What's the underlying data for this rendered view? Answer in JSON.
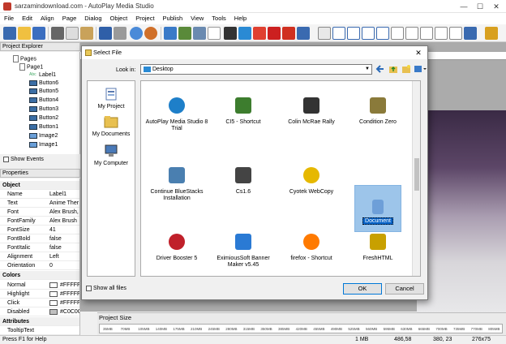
{
  "window": {
    "title": "sarzamindownload.com - AutoPlay Media Studio",
    "minimize": "—",
    "maximize": "☐",
    "close": "✕"
  },
  "menu": [
    "File",
    "Edit",
    "Align",
    "Page",
    "Dialog",
    "Object",
    "Project",
    "Publish",
    "View",
    "Tools",
    "Help"
  ],
  "project_explorer": {
    "title": "Project Explorer",
    "tree": [
      {
        "label": "Pages",
        "kind": "folder",
        "depth": 0
      },
      {
        "label": "Page1",
        "kind": "page",
        "depth": 1
      },
      {
        "label": "Label1",
        "kind": "label",
        "depth": 2
      },
      {
        "label": "Button6",
        "kind": "button",
        "depth": 2
      },
      {
        "label": "Button5",
        "kind": "button",
        "depth": 2
      },
      {
        "label": "Button4",
        "kind": "button",
        "depth": 2
      },
      {
        "label": "Button3",
        "kind": "button",
        "depth": 2
      },
      {
        "label": "Button2",
        "kind": "button",
        "depth": 2
      },
      {
        "label": "Button1",
        "kind": "button",
        "depth": 2
      },
      {
        "label": "Image2",
        "kind": "image",
        "depth": 2
      },
      {
        "label": "Image1",
        "kind": "image",
        "depth": 2
      }
    ],
    "show_events": "Show Events"
  },
  "properties": {
    "title": "Properties",
    "rows": [
      {
        "kind": "category",
        "key": "Object"
      },
      {
        "key": "Name",
        "value": "Label1"
      },
      {
        "key": "Text",
        "value": "Anime Ther"
      },
      {
        "key": "Font",
        "value": "Alex Brush,"
      },
      {
        "key": "FontFamily",
        "value": "Alex Brush"
      },
      {
        "key": "FontSize",
        "value": "41"
      },
      {
        "key": "FontBold",
        "value": "false"
      },
      {
        "key": "FontItalic",
        "value": "false"
      },
      {
        "key": "Alignment",
        "value": "Left"
      },
      {
        "key": "Orientation",
        "value": "0"
      },
      {
        "kind": "category",
        "key": "Colors"
      },
      {
        "key": "Normal",
        "value": "#FFFFF",
        "swatch": "#FFFFFF"
      },
      {
        "key": "Highlight",
        "value": "#FFFFF",
        "swatch": "#FFFFFF"
      },
      {
        "key": "Click",
        "value": "#FFFFFF",
        "swatch": "#FFFFFF"
      },
      {
        "key": "Disabled",
        "value": "#C0C0C0",
        "swatch": "#C0C0C0"
      },
      {
        "kind": "category",
        "key": "Attributes"
      },
      {
        "key": "TooltipText",
        "value": ""
      }
    ]
  },
  "dialog": {
    "title": "Select File",
    "look_in_label": "Look in:",
    "look_in_value": "Desktop",
    "places": [
      {
        "label": "My Project",
        "icon": "project-icon"
      },
      {
        "label": "My Documents",
        "icon": "documents-folder-icon"
      },
      {
        "label": "My Computer",
        "icon": "computer-icon"
      }
    ],
    "files": [
      {
        "label": "AutoPlay Media Studio 8 Trial",
        "icon": "autoplay-icon",
        "color": "#1e7fc9"
      },
      {
        "label": "CI5 - Shortcut",
        "icon": "game-ci5-icon",
        "color": "#3d7d2e"
      },
      {
        "label": "Colin McRae Rally",
        "icon": "rally-icon",
        "color": "#333333"
      },
      {
        "label": "Condition Zero",
        "icon": "counter-strike-icon",
        "color": "#8a7a3a"
      },
      {
        "label": "Continue BlueStacks Installation",
        "icon": "bluestacks-installer-icon",
        "color": "#4a7fb0"
      },
      {
        "label": "Cs1.6",
        "icon": "counter-strike-icon",
        "color": "#444444"
      },
      {
        "label": "Cyotek WebCopy",
        "icon": "webcopy-icon",
        "color": "#e6b800"
      },
      {
        "label": "Document",
        "icon": "text-document-icon",
        "color": "#6e9fd8",
        "selected": true
      },
      {
        "label": "Driver Booster 5",
        "icon": "driver-booster-icon",
        "color": "#c0202a"
      },
      {
        "label": "EximiousSoft Banner Maker v5.45",
        "icon": "banner-maker-icon",
        "color": "#2a7ad4"
      },
      {
        "label": "firefox - Shortcut",
        "icon": "firefox-icon",
        "color": "#ff7a00"
      },
      {
        "label": "FreshHTML",
        "icon": "freshhtml-icon",
        "color": "#c8a000"
      }
    ],
    "show_all_files": "Show all files",
    "ok": "OK",
    "cancel": "Cancel"
  },
  "project_size": {
    "title": "Project Size",
    "ticks": [
      "35MB",
      "70MB",
      "105MB",
      "140MB",
      "175MB",
      "210MB",
      "245MB",
      "280MB",
      "315MB",
      "350MB",
      "385MB",
      "420MB",
      "455MB",
      "490MB",
      "525MB",
      "560MB",
      "595MB",
      "630MB",
      "665MB",
      "700MB",
      "735MB",
      "770MB",
      "805MB"
    ]
  },
  "status": {
    "help": "Press F1 for Help",
    "size": "1 MB",
    "position": "486,58",
    "origin": "380, 23",
    "dimensions": "276x75"
  },
  "watermark": "sarzamindownload.com"
}
